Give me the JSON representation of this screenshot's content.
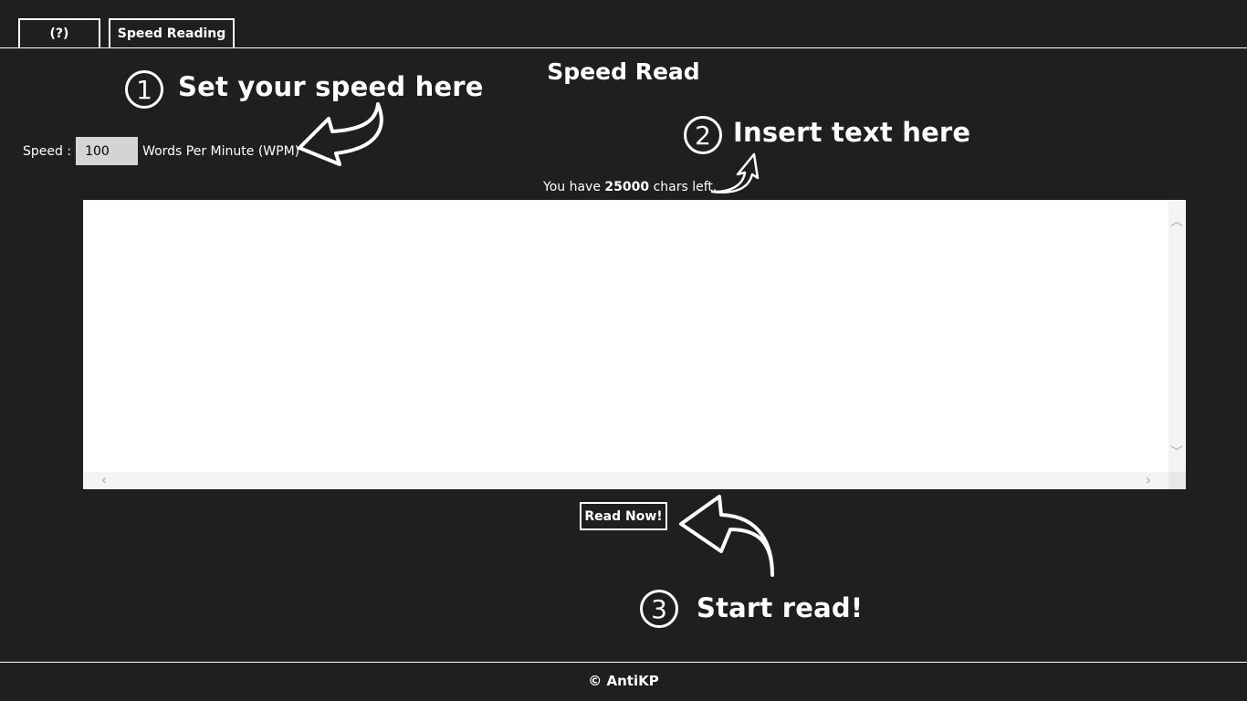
{
  "app": {
    "title": "Speed Read"
  },
  "tabs": [
    {
      "label": "(?)"
    },
    {
      "label": "Speed Reading"
    }
  ],
  "annotations": {
    "step1": {
      "number": "1",
      "text": "Set your speed here"
    },
    "step2": {
      "number": "2",
      "text": "Insert text here"
    },
    "step3": {
      "number": "3",
      "text": "Start read!"
    }
  },
  "speed": {
    "label": "Speed :",
    "value": "100",
    "unit": "Words Per Minute (WPM)"
  },
  "chars_left": {
    "prefix": "You have",
    "count": "25000",
    "suffix": "chars left."
  },
  "text_input": {
    "value": ""
  },
  "read_button": {
    "label": "Read Now!"
  },
  "footer": {
    "text": "© AntiKP"
  },
  "colors": {
    "background": "#1f1f1f",
    "foreground": "#ffffff",
    "input_bg": "#d4d4d4"
  }
}
